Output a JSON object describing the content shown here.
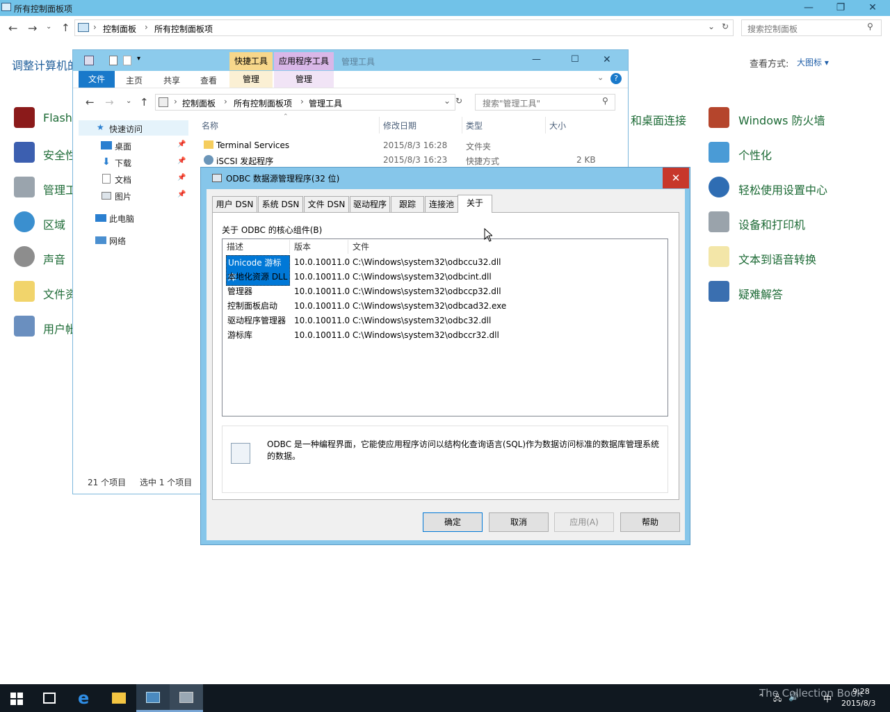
{
  "control_panel": {
    "title": "所有控制面板项",
    "breadcrumb": [
      "控制面板",
      "所有控制面板项"
    ],
    "search_placeholder": "搜索控制面板",
    "heading": "调整计算机的",
    "view_label": "查看方式:",
    "view_value": "大图标 ▾",
    "items_left": [
      "Flash",
      "安全性",
      "管理工",
      "区域",
      "声音",
      "文件资",
      "用户帐"
    ],
    "items_middle": [
      "和桌面连接"
    ],
    "items_right": [
      "Windows 防火墙",
      "个性化",
      "轻松使用设置中心",
      "设备和打印机",
      "文本到语音转换",
      "疑难解答"
    ]
  },
  "explorer": {
    "context_tabs": [
      "快捷工具",
      "应用程序工具",
      "管理工具"
    ],
    "ribbon_tabs": [
      "文件",
      "主页",
      "共享",
      "查看",
      "管理",
      "管理"
    ],
    "breadcrumb": [
      "控制面板",
      "所有控制面板项",
      "管理工具"
    ],
    "search_placeholder": "搜索\"管理工具\"",
    "nav": {
      "quick_access": "快速访问",
      "items": [
        "桌面",
        "下载",
        "文档",
        "图片"
      ],
      "this_pc": "此电脑",
      "network": "网络"
    },
    "columns": [
      "名称",
      "修改日期",
      "类型",
      "大小"
    ],
    "files": [
      {
        "name": "Terminal Services",
        "date": "2015/8/3 16:28",
        "type": "文件夹",
        "size": ""
      },
      {
        "name": "iSCSI 发起程序",
        "date": "2015/8/3 16:23",
        "type": "快捷方式",
        "size": "2 KB"
      }
    ],
    "status_count": "21 个项目",
    "status_selected": "选中 1 个项目"
  },
  "dialog": {
    "title": "ODBC 数据源管理程序(32 位)",
    "tabs": [
      "用户 DSN",
      "系统 DSN",
      "文件 DSN",
      "驱动程序",
      "跟踪",
      "连接池",
      "关于"
    ],
    "group_label": "关于 ODBC 的核心组件(B)",
    "columns": [
      "描述",
      "版本",
      "文件"
    ],
    "rows": [
      {
        "desc": "Unicode 游标库",
        "version": "10.0.10011.0",
        "file": "C:\\Windows\\system32\\odbccu32.dll"
      },
      {
        "desc": "本地化资源 DLL",
        "version": "10.0.10011.0",
        "file": "C:\\Windows\\system32\\odbcint.dll"
      },
      {
        "desc": "管理器",
        "version": "10.0.10011.0",
        "file": "C:\\Windows\\system32\\odbccp32.dll"
      },
      {
        "desc": "控制面板启动",
        "version": "10.0.10011.0",
        "file": "C:\\Windows\\system32\\odbcad32.exe"
      },
      {
        "desc": "驱动程序管理器",
        "version": "10.0.10011.0",
        "file": "C:\\Windows\\system32\\odbc32.dll"
      },
      {
        "desc": "游标库",
        "version": "10.0.10011.0",
        "file": "C:\\Windows\\system32\\odbccr32.dll"
      }
    ],
    "info_line1": "ODBC 是一种编程界面，它能使应用程序访问以结构化查询语言(SQL)作为数据访问标准的数据库管理系统",
    "info_line2": "的数据。",
    "buttons": {
      "ok": "确定",
      "cancel": "取消",
      "apply": "应用(A)",
      "help": "帮助"
    }
  },
  "taskbar": {
    "time": "9:28",
    "date": "2015/8/3",
    "ime": "中",
    "watermark": "The Collection Book"
  }
}
